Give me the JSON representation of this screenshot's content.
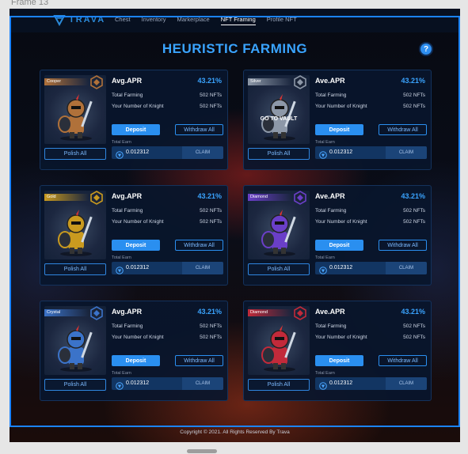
{
  "frame_label": "Frame 13",
  "nav": {
    "logo_text": "TRAVA",
    "links": [
      "Chest",
      "Inventory",
      "Markerplace",
      "NFT Framing",
      "Profile NFT"
    ],
    "active_index": 3
  },
  "page_title": "HEURISTIC FARMING",
  "help_symbol": "?",
  "cards": [
    {
      "rank": "Cooper",
      "rank_color": "#b0713a",
      "apr_label": "Avg.APR",
      "apr_value": "43.21%",
      "total_farming_label": "Total Farming",
      "total_farming_value": "502 NFTs",
      "knights_label": "Your Number of Knight",
      "knights_value": "502 NFTs",
      "deposit": "Deposit",
      "withdraw": "Withdraw All",
      "earn_label": "Total Earn",
      "earn_value": "0.012312",
      "claim": "CLAIM",
      "polish": "Polish All",
      "vault_text": ""
    },
    {
      "rank": "Silver",
      "rank_color": "#8d98a8",
      "apr_label": "Ave.APR",
      "apr_value": "43.21%",
      "total_farming_label": "Total Farming",
      "total_farming_value": "502 NFTs",
      "knights_label": "Your Number of Knight",
      "knights_value": "502 NFTs",
      "deposit": "Deposit",
      "withdraw": "Withdraw All",
      "earn_label": "Total Earn",
      "earn_value": "0.012312",
      "claim": "CLAIM",
      "polish": "Polish All",
      "vault_text": "GO TO VAULT"
    },
    {
      "rank": "Gold",
      "rank_color": "#c99a1f",
      "apr_label": "Avg.APR",
      "apr_value": "43.21%",
      "total_farming_label": "Total Farming",
      "total_farming_value": "502 NFTs",
      "knights_label": "Your Number of Knight",
      "knights_value": "502 NFTs",
      "deposit": "Deposit",
      "withdraw": "Withdraw All",
      "earn_label": "Total Earn",
      "earn_value": "0.012312",
      "claim": "CLAIM",
      "polish": "Polish All",
      "vault_text": ""
    },
    {
      "rank": "Diamond",
      "rank_color": "#6a3fc8",
      "apr_label": "Ave.APR",
      "apr_value": "43.21%",
      "total_farming_label": "Total Farming",
      "total_farming_value": "502 NFTs",
      "knights_label": "Your Number of Knight",
      "knights_value": "502 NFTs",
      "deposit": "Deposit",
      "withdraw": "Withdraw All",
      "earn_label": "Total Earn",
      "earn_value": "0.012312",
      "claim": "CLAIM",
      "polish": "Polish All",
      "vault_text": ""
    },
    {
      "rank": "Crystal",
      "rank_color": "#3b73c9",
      "apr_label": "Avg.APR",
      "apr_value": "43.21%",
      "total_farming_label": "Total Farming",
      "total_farming_value": "502 NFTs",
      "knights_label": "Your Number of Knight",
      "knights_value": "502 NFTs",
      "deposit": "Deposit",
      "withdraw": "Withdraw All",
      "earn_label": "Total Earn",
      "earn_value": "0.012312",
      "claim": "CLAIM",
      "polish": "Polish All",
      "vault_text": ""
    },
    {
      "rank": "Diamond",
      "rank_color": "#c22a3a",
      "apr_label": "Ave.APR",
      "apr_value": "43.21%",
      "total_farming_label": "Total Farming",
      "total_farming_value": "502 NFTs",
      "knights_label": "Your Number of Knight",
      "knights_value": "502 NFTs",
      "deposit": "Deposit",
      "withdraw": "Withdraw All",
      "earn_label": "Total Earn",
      "earn_value": "0.012312",
      "claim": "CLAIM",
      "polish": "Polish All",
      "vault_text": ""
    }
  ],
  "footer": "Copyright © 2021. All Rights Reserved By Trava"
}
